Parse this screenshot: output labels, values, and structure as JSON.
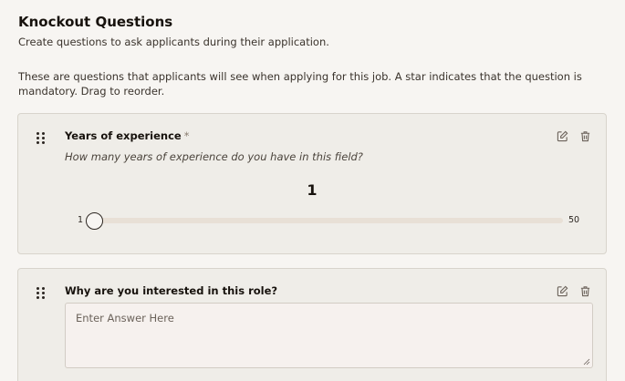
{
  "page": {
    "title": "Knockout Questions",
    "subtitle": "Create questions to ask applicants during their application.",
    "intro": "These are questions that applicants will see when applying for this job. A star indicates that the question is mandatory. Drag to reorder."
  },
  "questions": [
    {
      "title": "Years of experience",
      "required_marker": "*",
      "description": "How many years of experience do you have in this field?",
      "slider": {
        "value": "1",
        "min": "1",
        "max": "50"
      }
    },
    {
      "title": "Why are you interested in this role?",
      "answer_placeholder": "Enter Answer Here"
    }
  ],
  "icons": {
    "edit": "edit-icon",
    "delete": "trash-icon",
    "drag": "drag-handle-icon"
  }
}
